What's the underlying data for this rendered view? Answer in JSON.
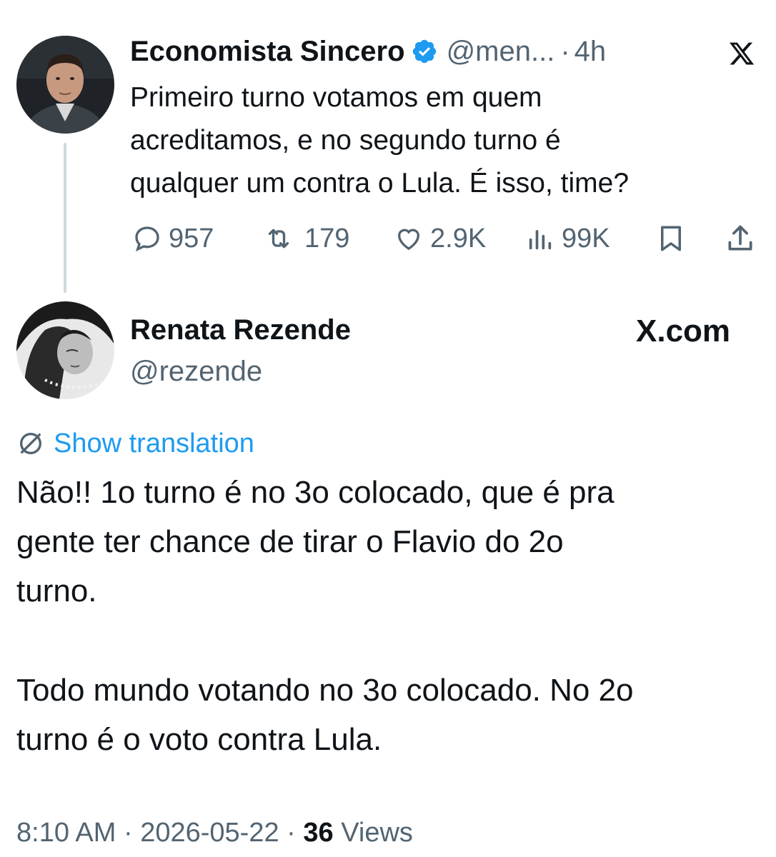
{
  "parent_tweet": {
    "display_name": "Economista Sincero",
    "handle": "@men...",
    "separator": "·",
    "time_ago": "4h",
    "lines": [
      "Primeiro turno votamos em quem",
      "acreditamos, e no segundo turno é",
      "qualquer um contra o Lula. É isso, time?"
    ],
    "stats": {
      "replies": "957",
      "reposts": "179",
      "likes": "2.9K",
      "views": "99K"
    }
  },
  "reply_tweet": {
    "display_name": "Renata Rezende",
    "handle": "@rezende",
    "brand_label": "X.com",
    "translate_label": "Show translation",
    "paragraph1_lines": [
      "Não!! 1o turno é no 3o colocado, que é pra",
      "gente ter chance de tirar o Flavio do 2o",
      "turno."
    ],
    "paragraph2_lines": [
      "Todo mundo votando no 3o colocado. No 2o",
      "turno é o voto contra Lula."
    ],
    "footer": {
      "time": "8:10 AM",
      "sep1": "·",
      "date": "2026-05-22",
      "sep2": "·",
      "views_count": "36",
      "views_label": "Views"
    }
  },
  "colors": {
    "text": "#0f1419",
    "secondary": "#536471",
    "link": "#1d9bf0",
    "verified": "#1d9bf0",
    "thread_line": "#cfd9de"
  }
}
